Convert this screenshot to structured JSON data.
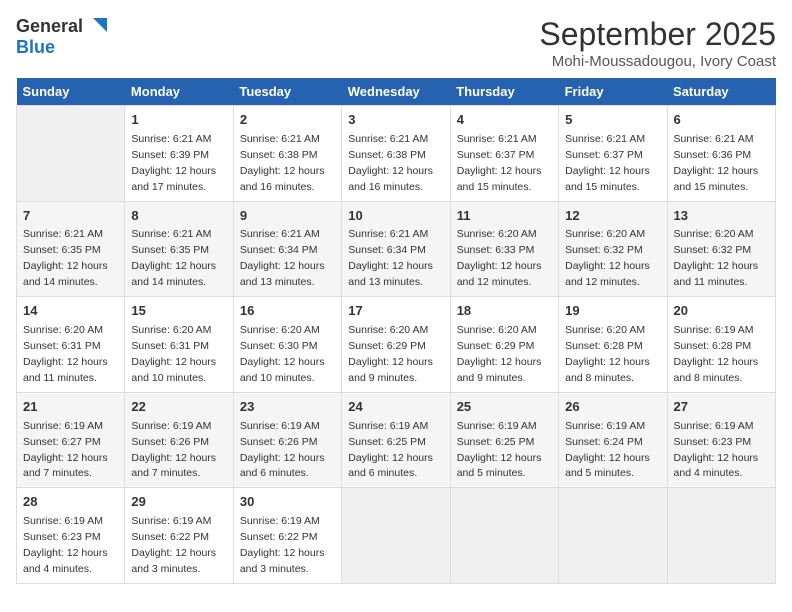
{
  "logo": {
    "line1": "General",
    "line2": "Blue"
  },
  "title": "September 2025",
  "location": "Mohi-Moussadougou, Ivory Coast",
  "days_of_week": [
    "Sunday",
    "Monday",
    "Tuesday",
    "Wednesday",
    "Thursday",
    "Friday",
    "Saturday"
  ],
  "weeks": [
    [
      {
        "num": "",
        "sunrise": "",
        "sunset": "",
        "daylight": "",
        "empty": true
      },
      {
        "num": "1",
        "sunrise": "Sunrise: 6:21 AM",
        "sunset": "Sunset: 6:39 PM",
        "daylight": "Daylight: 12 hours and 17 minutes."
      },
      {
        "num": "2",
        "sunrise": "Sunrise: 6:21 AM",
        "sunset": "Sunset: 6:38 PM",
        "daylight": "Daylight: 12 hours and 16 minutes."
      },
      {
        "num": "3",
        "sunrise": "Sunrise: 6:21 AM",
        "sunset": "Sunset: 6:38 PM",
        "daylight": "Daylight: 12 hours and 16 minutes."
      },
      {
        "num": "4",
        "sunrise": "Sunrise: 6:21 AM",
        "sunset": "Sunset: 6:37 PM",
        "daylight": "Daylight: 12 hours and 15 minutes."
      },
      {
        "num": "5",
        "sunrise": "Sunrise: 6:21 AM",
        "sunset": "Sunset: 6:37 PM",
        "daylight": "Daylight: 12 hours and 15 minutes."
      },
      {
        "num": "6",
        "sunrise": "Sunrise: 6:21 AM",
        "sunset": "Sunset: 6:36 PM",
        "daylight": "Daylight: 12 hours and 15 minutes."
      }
    ],
    [
      {
        "num": "7",
        "sunrise": "Sunrise: 6:21 AM",
        "sunset": "Sunset: 6:35 PM",
        "daylight": "Daylight: 12 hours and 14 minutes."
      },
      {
        "num": "8",
        "sunrise": "Sunrise: 6:21 AM",
        "sunset": "Sunset: 6:35 PM",
        "daylight": "Daylight: 12 hours and 14 minutes."
      },
      {
        "num": "9",
        "sunrise": "Sunrise: 6:21 AM",
        "sunset": "Sunset: 6:34 PM",
        "daylight": "Daylight: 12 hours and 13 minutes."
      },
      {
        "num": "10",
        "sunrise": "Sunrise: 6:21 AM",
        "sunset": "Sunset: 6:34 PM",
        "daylight": "Daylight: 12 hours and 13 minutes."
      },
      {
        "num": "11",
        "sunrise": "Sunrise: 6:20 AM",
        "sunset": "Sunset: 6:33 PM",
        "daylight": "Daylight: 12 hours and 12 minutes."
      },
      {
        "num": "12",
        "sunrise": "Sunrise: 6:20 AM",
        "sunset": "Sunset: 6:32 PM",
        "daylight": "Daylight: 12 hours and 12 minutes."
      },
      {
        "num": "13",
        "sunrise": "Sunrise: 6:20 AM",
        "sunset": "Sunset: 6:32 PM",
        "daylight": "Daylight: 12 hours and 11 minutes."
      }
    ],
    [
      {
        "num": "14",
        "sunrise": "Sunrise: 6:20 AM",
        "sunset": "Sunset: 6:31 PM",
        "daylight": "Daylight: 12 hours and 11 minutes."
      },
      {
        "num": "15",
        "sunrise": "Sunrise: 6:20 AM",
        "sunset": "Sunset: 6:31 PM",
        "daylight": "Daylight: 12 hours and 10 minutes."
      },
      {
        "num": "16",
        "sunrise": "Sunrise: 6:20 AM",
        "sunset": "Sunset: 6:30 PM",
        "daylight": "Daylight: 12 hours and 10 minutes."
      },
      {
        "num": "17",
        "sunrise": "Sunrise: 6:20 AM",
        "sunset": "Sunset: 6:29 PM",
        "daylight": "Daylight: 12 hours and 9 minutes."
      },
      {
        "num": "18",
        "sunrise": "Sunrise: 6:20 AM",
        "sunset": "Sunset: 6:29 PM",
        "daylight": "Daylight: 12 hours and 9 minutes."
      },
      {
        "num": "19",
        "sunrise": "Sunrise: 6:20 AM",
        "sunset": "Sunset: 6:28 PM",
        "daylight": "Daylight: 12 hours and 8 minutes."
      },
      {
        "num": "20",
        "sunrise": "Sunrise: 6:19 AM",
        "sunset": "Sunset: 6:28 PM",
        "daylight": "Daylight: 12 hours and 8 minutes."
      }
    ],
    [
      {
        "num": "21",
        "sunrise": "Sunrise: 6:19 AM",
        "sunset": "Sunset: 6:27 PM",
        "daylight": "Daylight: 12 hours and 7 minutes."
      },
      {
        "num": "22",
        "sunrise": "Sunrise: 6:19 AM",
        "sunset": "Sunset: 6:26 PM",
        "daylight": "Daylight: 12 hours and 7 minutes."
      },
      {
        "num": "23",
        "sunrise": "Sunrise: 6:19 AM",
        "sunset": "Sunset: 6:26 PM",
        "daylight": "Daylight: 12 hours and 6 minutes."
      },
      {
        "num": "24",
        "sunrise": "Sunrise: 6:19 AM",
        "sunset": "Sunset: 6:25 PM",
        "daylight": "Daylight: 12 hours and 6 minutes."
      },
      {
        "num": "25",
        "sunrise": "Sunrise: 6:19 AM",
        "sunset": "Sunset: 6:25 PM",
        "daylight": "Daylight: 12 hours and 5 minutes."
      },
      {
        "num": "26",
        "sunrise": "Sunrise: 6:19 AM",
        "sunset": "Sunset: 6:24 PM",
        "daylight": "Daylight: 12 hours and 5 minutes."
      },
      {
        "num": "27",
        "sunrise": "Sunrise: 6:19 AM",
        "sunset": "Sunset: 6:23 PM",
        "daylight": "Daylight: 12 hours and 4 minutes."
      }
    ],
    [
      {
        "num": "28",
        "sunrise": "Sunrise: 6:19 AM",
        "sunset": "Sunset: 6:23 PM",
        "daylight": "Daylight: 12 hours and 4 minutes."
      },
      {
        "num": "29",
        "sunrise": "Sunrise: 6:19 AM",
        "sunset": "Sunset: 6:22 PM",
        "daylight": "Daylight: 12 hours and 3 minutes."
      },
      {
        "num": "30",
        "sunrise": "Sunrise: 6:19 AM",
        "sunset": "Sunset: 6:22 PM",
        "daylight": "Daylight: 12 hours and 3 minutes."
      },
      {
        "num": "",
        "sunrise": "",
        "sunset": "",
        "daylight": "",
        "empty": true
      },
      {
        "num": "",
        "sunrise": "",
        "sunset": "",
        "daylight": "",
        "empty": true
      },
      {
        "num": "",
        "sunrise": "",
        "sunset": "",
        "daylight": "",
        "empty": true
      },
      {
        "num": "",
        "sunrise": "",
        "sunset": "",
        "daylight": "",
        "empty": true
      }
    ]
  ]
}
